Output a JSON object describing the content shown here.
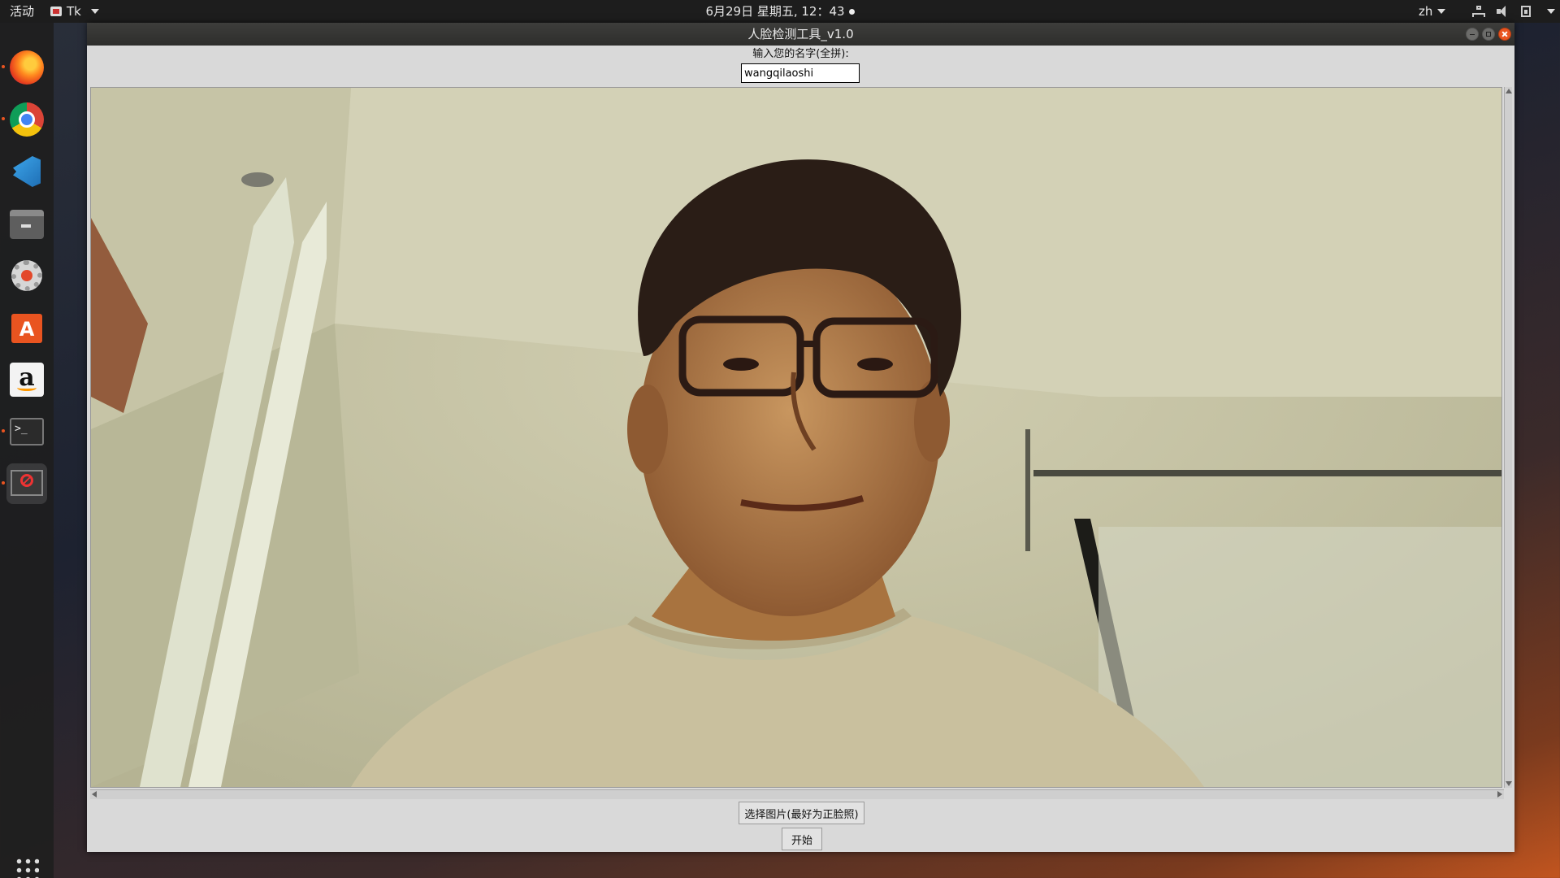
{
  "topbar": {
    "activities": "活动",
    "app_name": "Tk",
    "clock": "6月29日 星期五, 12：43",
    "language": "zh"
  },
  "dock": {
    "apps": [
      "Firefox",
      "Chrome",
      "Visual Studio Code",
      "Files",
      "Settings",
      "Ubuntu Software",
      "Amazon",
      "Terminal",
      "Tk"
    ]
  },
  "window": {
    "title": "人脸检测工具_v1.0",
    "name_label": "输入您的名字(全拼):",
    "name_value": "wangqilaoshi",
    "choose_image_label": "选择图片(最好为正脸照)",
    "start_label": "开始"
  }
}
